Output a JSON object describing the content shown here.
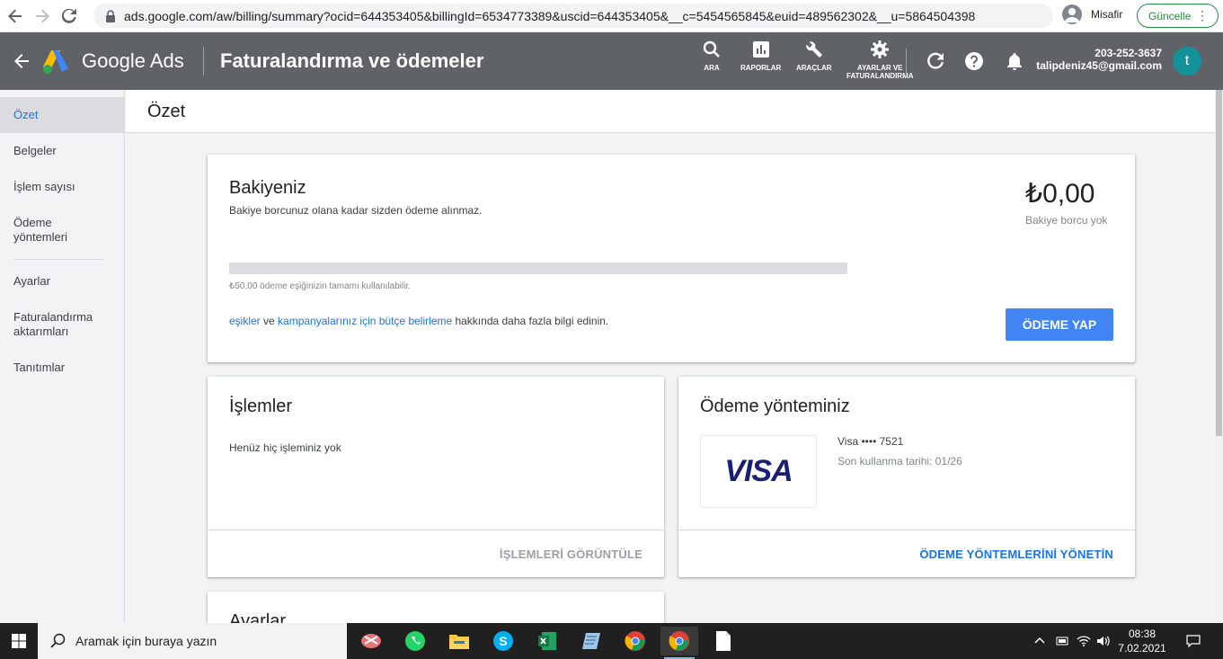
{
  "browser": {
    "url": "ads.google.com/aw/billing/summary?ocid=644353405&billingId=6534773389&uscid=644353405&__c=5454565845&euid=489562302&__u=5864504398",
    "profile_label": "Misafir",
    "update_label": "Güncelle"
  },
  "header": {
    "brand": "Google Ads",
    "page_title": "Faturalandırma ve ödemeler",
    "tools": {
      "search": "ARA",
      "reports": "RAPORLAR",
      "tools": "ARAÇLAR",
      "settings_line1": "AYARLAR VE",
      "settings_line2": "FATURALANDIRMA"
    },
    "account_id": "203-252-3637",
    "account_email": "talipdeniz45@gmail.com",
    "avatar_letter": "t"
  },
  "sidebar": {
    "items": [
      {
        "label": "Özet"
      },
      {
        "label": "Belgeler"
      },
      {
        "label": "İşlem sayısı"
      },
      {
        "label": "Ödeme yöntemleri"
      },
      {
        "label": "Ayarlar"
      },
      {
        "label": "Faturalandırma aktarımları"
      },
      {
        "label": "Tanıtımlar"
      }
    ]
  },
  "main": {
    "title": "Özet",
    "balance_card": {
      "title": "Bakiyeniz",
      "subtitle": "Bakiye borcunuz olana kadar sizden ödeme alınmaz.",
      "amount": "₺0,00",
      "amount_note": "Bakiye borcu yok",
      "progress_fraction": 0,
      "threshold_note": "₺50,00 ödeme eşiğinizin tamamı kullanılabilir.",
      "info_link1": "eşikler",
      "info_and": " ve ",
      "info_link2": "kampanyalarınız için bütçe belirleme",
      "info_rest": " hakkında daha fazla bilgi edinin.",
      "pay_button": "ÖDEME YAP"
    },
    "transactions_card": {
      "title": "İşlemler",
      "empty_text": "Henüz hiç işleminiz yok",
      "footer_link": "İŞLEMLERİ GÖRÜNTÜLE"
    },
    "payment_card": {
      "title": "Ödeme yönteminiz",
      "card_brand": "VISA",
      "card_label": "Visa •••• 7521",
      "expiry": "Son kullanma tarihi: 01/26",
      "footer_link": "ÖDEME YÖNTEMLERİNİ YÖNETİN"
    },
    "settings_card": {
      "title": "Ayarlar"
    }
  },
  "taskbar": {
    "search_placeholder": "Aramak için buraya yazın",
    "time": "08:38",
    "date": "7.02.2021"
  },
  "colors": {
    "header_bg": "#5f6368",
    "accent_blue": "#1a73e8",
    "button_blue": "#4285f4",
    "avatar_teal": "#12939a",
    "update_green": "#1e8e3e"
  }
}
